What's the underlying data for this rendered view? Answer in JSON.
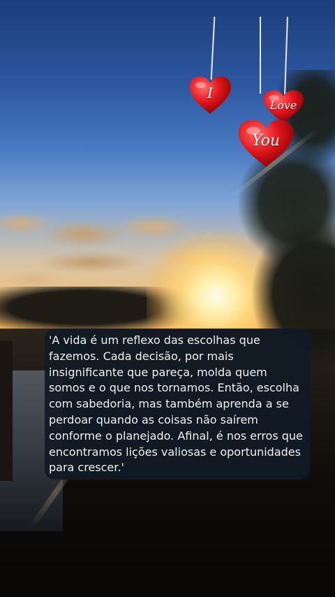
{
  "hearts": [
    {
      "label": "I"
    },
    {
      "label": "Love"
    },
    {
      "label": "You"
    }
  ],
  "quote": {
    "text": "'A vida é um reflexo das escolhas que fazemos. Cada decisão, por mais insignificante que pareça, molda quem somos e o que nos tornamos. Então, escolha com sabedoria, mas também aprenda a se perdoar quando as coisas não saírem conforme o planejado. Afinal, é nos erros que encontramos lições valiosas e oportunidades para crescer.'"
  },
  "colors": {
    "quote_bg": "#111a26",
    "heart_red": "#e0161b",
    "quote_text": "#f2f2f2"
  }
}
